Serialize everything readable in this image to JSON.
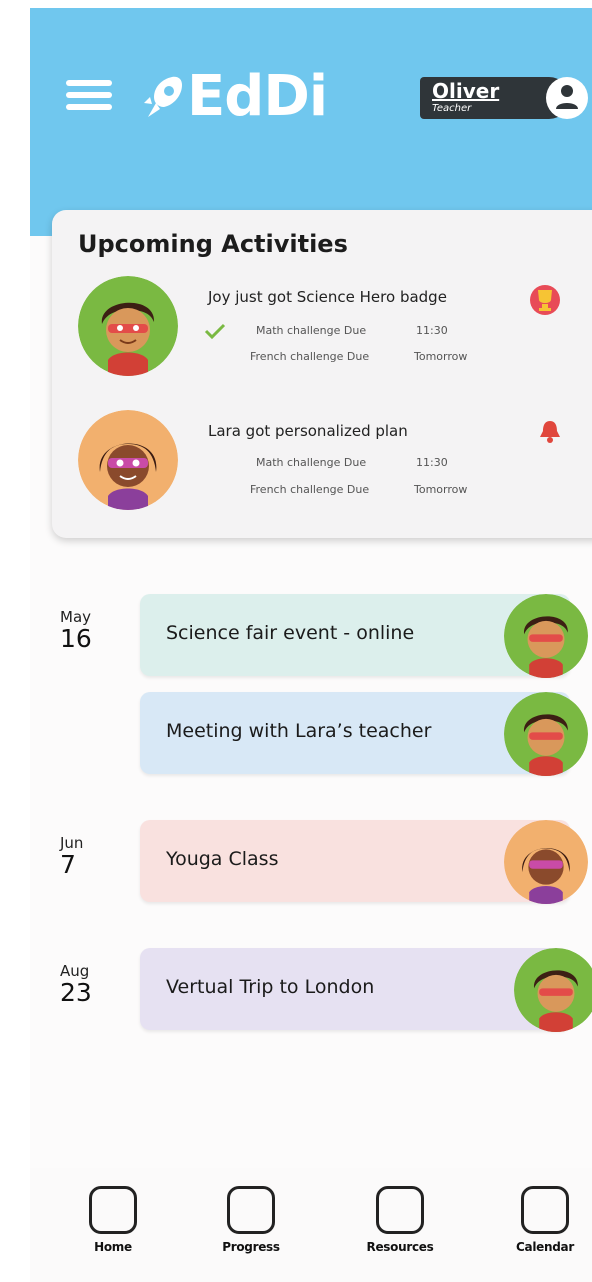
{
  "header": {
    "logo_text": "EdDi",
    "user_name": "Oliver",
    "user_role": "Teacher"
  },
  "upcoming": {
    "title": "Upcoming Activities",
    "activities": [
      {
        "headline": "Joy just got Science Hero badge",
        "avatar": "green-hero-avatar",
        "badge_icon": "trophy-icon",
        "items": [
          {
            "label": "Math challenge Due",
            "time": "11:30",
            "done": true
          },
          {
            "label": "French challenge Due",
            "time": "Tomorrow",
            "done": false
          }
        ]
      },
      {
        "headline": "Lara got personalized plan",
        "avatar": "orange-hero-avatar",
        "badge_icon": "bell-icon",
        "items": [
          {
            "label": "Math challenge Due",
            "time": "11:30",
            "done": false
          },
          {
            "label": "French challenge Due",
            "time": "Tomorrow",
            "done": false
          }
        ]
      }
    ]
  },
  "calendar": {
    "days": [
      {
        "month": "May",
        "day": "16"
      },
      {
        "month": "Jun",
        "day": "7"
      },
      {
        "month": "Aug",
        "day": "23"
      }
    ],
    "events": [
      {
        "title": "Science fair event - online",
        "color": "#dcefec"
      },
      {
        "title": "Meeting with Lara’s teacher",
        "color": "#d8e8f6"
      },
      {
        "title": "Youga Class",
        "color": "#f9e1df"
      },
      {
        "title": "Vertual Trip to London",
        "color": "#e6e1f2"
      }
    ]
  },
  "nav": [
    {
      "label": "Home"
    },
    {
      "label": "Progress"
    },
    {
      "label": "Resources"
    },
    {
      "label": "Calendar"
    }
  ],
  "colors": {
    "header": "#70c7ee",
    "hero_green": "#7ab942",
    "hero_orange": "#f2b06e"
  }
}
